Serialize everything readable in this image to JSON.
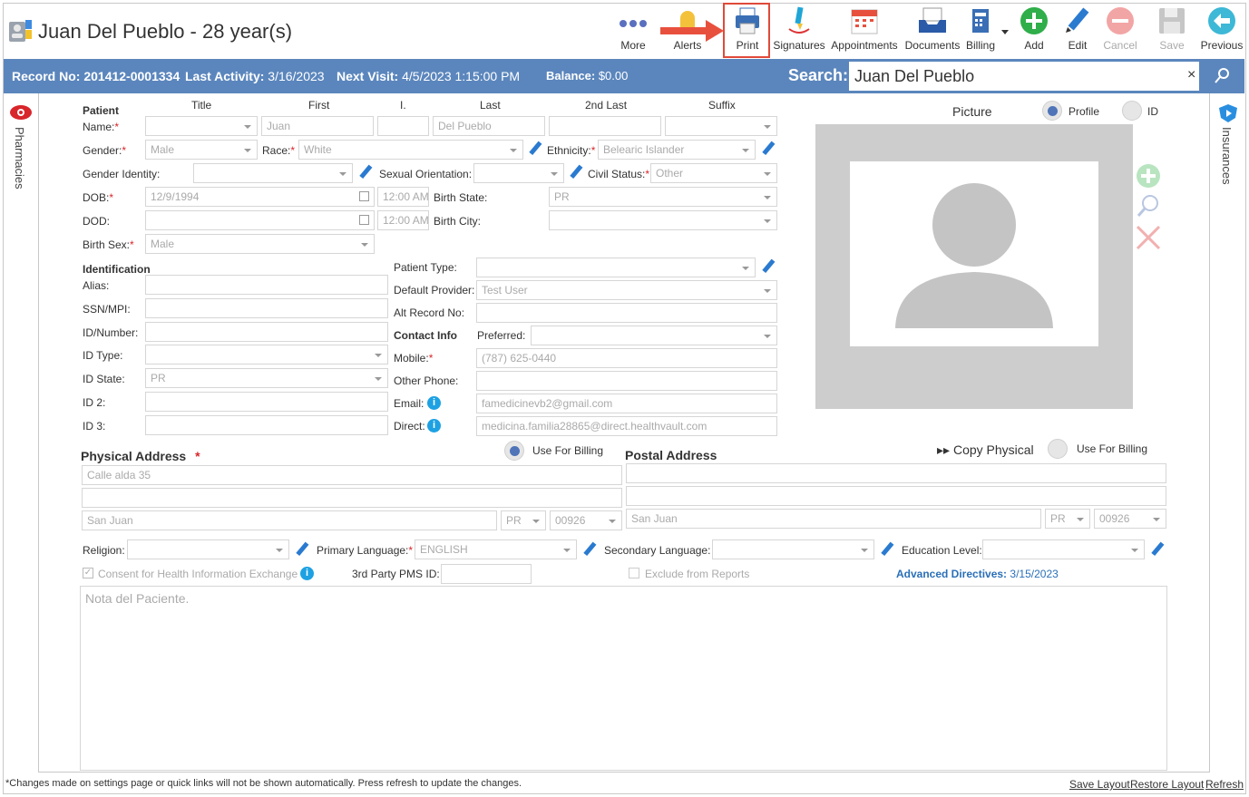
{
  "header": {
    "title": "Juan Del Pueblo - 28 year(s)"
  },
  "toolbar": {
    "more": "More",
    "alerts": "Alerts",
    "print": "Print",
    "signatures": "Signatures",
    "appointments": "Appointments",
    "documents": "Documents",
    "billing": "Billing",
    "add": "Add",
    "edit": "Edit",
    "cancel": "Cancel",
    "save": "Save",
    "previous": "Previous"
  },
  "record_bar": {
    "record_label": "Record No:",
    "record_value": "201412-0001334",
    "activity_label": "Last Activity:",
    "activity_value": "3/16/2023",
    "visit_label": "Next Visit:",
    "visit_value": "4/5/2023 1:15:00 PM",
    "balance_label": "Balance:",
    "balance_value": "$0.00",
    "search_label": "Search:",
    "search_value": "Juan Del Pueblo",
    "clear": "×"
  },
  "side": {
    "left": "Pharmacies",
    "right": "Insurances"
  },
  "patient": {
    "section": "Patient",
    "col_title": "Title",
    "col_first": "First",
    "col_i": "I.",
    "col_last": "Last",
    "col_2ndlast": "2nd Last",
    "col_suffix": "Suffix",
    "name_label": "Name:",
    "first": "Juan",
    "last": "Del Pueblo",
    "gender_label": "Gender:",
    "gender": "Male",
    "race_label": "Race:",
    "race": "White",
    "ethnicity_label": "Ethnicity:",
    "ethnicity": "Belearic Islander",
    "gender_identity_label": "Gender Identity:",
    "sexual_orientation_label": "Sexual Orientation:",
    "civil_status_label": "Civil Status:",
    "civil_status": "Other",
    "dob_label": "DOB:",
    "dob": "12/9/1994",
    "dob_time": "12:00 AM",
    "birth_state_label": "Birth State:",
    "birth_state": "PR",
    "dod_label": "DOD:",
    "dod_time": "12:00 AM",
    "birth_city_label": "Birth City:",
    "birth_sex_label": "Birth Sex:",
    "birth_sex": "Male"
  },
  "identification": {
    "section": "Identification",
    "alias_label": "Alias:",
    "ssn_label": "SSN/MPI:",
    "idnum_label": "ID/Number:",
    "idtype_label": "ID Type:",
    "idstate_label": "ID State:",
    "idstate": "PR",
    "id2_label": "ID 2:",
    "id3_label": "ID 3:"
  },
  "details": {
    "patient_type_label": "Patient Type:",
    "provider_label": "Default Provider:",
    "provider": "Test User",
    "alt_record_label": "Alt Record No:",
    "contact_section": "Contact Info",
    "preferred_label": "Preferred:",
    "mobile_label": "Mobile:",
    "mobile": "(787) 625-0440",
    "other_phone_label": "Other Phone:",
    "email_label": "Email:",
    "email": "famedicinevb2@gmail.com",
    "direct_label": "Direct:",
    "direct": "medicina.familia28865@direct.healthvault.com"
  },
  "picture": {
    "label": "Picture",
    "profile": "Profile",
    "id": "ID"
  },
  "physical": {
    "title": "Physical Address",
    "req": "*",
    "use_billing": "Use For Billing",
    "line1": "Calle alda 35",
    "city": "San Juan",
    "state": "PR",
    "zip": "00926"
  },
  "postal": {
    "title": "Postal Address",
    "copy": "Copy Physical",
    "use_billing": "Use For Billing",
    "city": "San Juan",
    "state": "PR",
    "zip": "00926"
  },
  "misc": {
    "religion_label": "Religion:",
    "primary_lang_label": "Primary Language:",
    "primary_lang": "ENGLISH",
    "secondary_lang_label": "Secondary Language:",
    "education_label": "Education Level:",
    "consent": "Consent for Health Information Exchange",
    "third_party_label": "3rd Party PMS ID:",
    "exclude": "Exclude from Reports",
    "adv_label": "Advanced Directives:",
    "adv_value": "3/15/2023",
    "notes_placeholder": "Nota del Paciente."
  },
  "footer": {
    "notice": "*Changes made on settings page or quick links will not be shown automatically. Press refresh to update the changes.",
    "save_layout": "Save Layout",
    "restore_layout": "Restore Layout",
    "refresh": "Refresh"
  }
}
